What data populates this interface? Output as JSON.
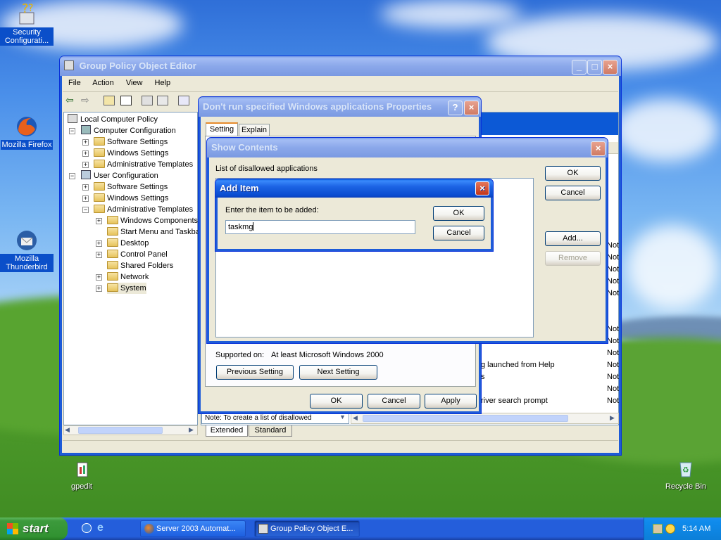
{
  "desktop": {
    "icons": [
      {
        "label": "Security Configurati...",
        "icon": "security-config-icon"
      },
      {
        "label": "Mozilla Firefox",
        "icon": "firefox-icon"
      },
      {
        "label": "Mozilla Thunderbird",
        "icon": "thunderbird-icon"
      },
      {
        "label": "gpedit",
        "icon": "gpedit-icon"
      },
      {
        "label": "Recycle Bin",
        "icon": "recycle-bin-icon"
      }
    ]
  },
  "gpo_window": {
    "title": "Group Policy Object Editor",
    "menu": [
      "File",
      "Action",
      "View",
      "Help"
    ],
    "tree": [
      "Local Computer Policy",
      "Computer Configuration",
      "Software Settings",
      "Windows Settings",
      "Administrative Templates",
      "User Configuration",
      "Software Settings",
      "Windows Settings",
      "Administrative Templates",
      "Windows Components",
      "Start Menu and Taskba",
      "Desktop",
      "Control Panel",
      "Shared Folders",
      "Network",
      "System"
    ],
    "right_rows": [
      {
        "name": "",
        "state": "Not"
      },
      {
        "name": "",
        "state": "Not"
      },
      {
        "name": "",
        "state": "Not"
      },
      {
        "name": "",
        "state": "Not"
      },
      {
        "name": "",
        "state": "Not"
      },
      {
        "name": "",
        "state": "Not"
      },
      {
        "name": "",
        "state": "Not"
      },
      {
        "name": "",
        "state": "Not"
      },
      {
        "name": "g launched from Help",
        "state": "Not"
      },
      {
        "name": "s",
        "state": "Not"
      },
      {
        "name": "",
        "state": "Not"
      },
      {
        "name": "river search prompt",
        "state": "Not"
      }
    ],
    "note_text": "Note: To create a list of disallowed",
    "tabs": [
      "Extended",
      "Standard"
    ]
  },
  "properties_dialog": {
    "title": "Don't run specified Windows applications Properties",
    "tabs": [
      "Setting",
      "Explain"
    ],
    "supported_label": "Supported on:",
    "supported_value": "At least Microsoft Windows 2000",
    "prev_button": "Previous Setting",
    "next_button": "Next Setting",
    "ok": "OK",
    "cancel": "Cancel",
    "apply": "Apply"
  },
  "show_contents": {
    "title": "Show Contents",
    "list_label": "List of disallowed applications",
    "ok": "OK",
    "cancel": "Cancel",
    "add": "Add...",
    "remove": "Remove"
  },
  "add_item": {
    "title": "Add Item",
    "prompt": "Enter the item to be added:",
    "value": "taskmg",
    "ok": "OK",
    "cancel": "Cancel"
  },
  "taskbar": {
    "start": "start",
    "tasks": [
      "Server 2003 Automat...",
      "Group Policy Object E..."
    ],
    "clock": "5:14 AM"
  },
  "colors": {
    "xp_blue": "#0a4cd0",
    "start_green": "#3c9a3c",
    "tray_blue": "#0f8bec"
  }
}
